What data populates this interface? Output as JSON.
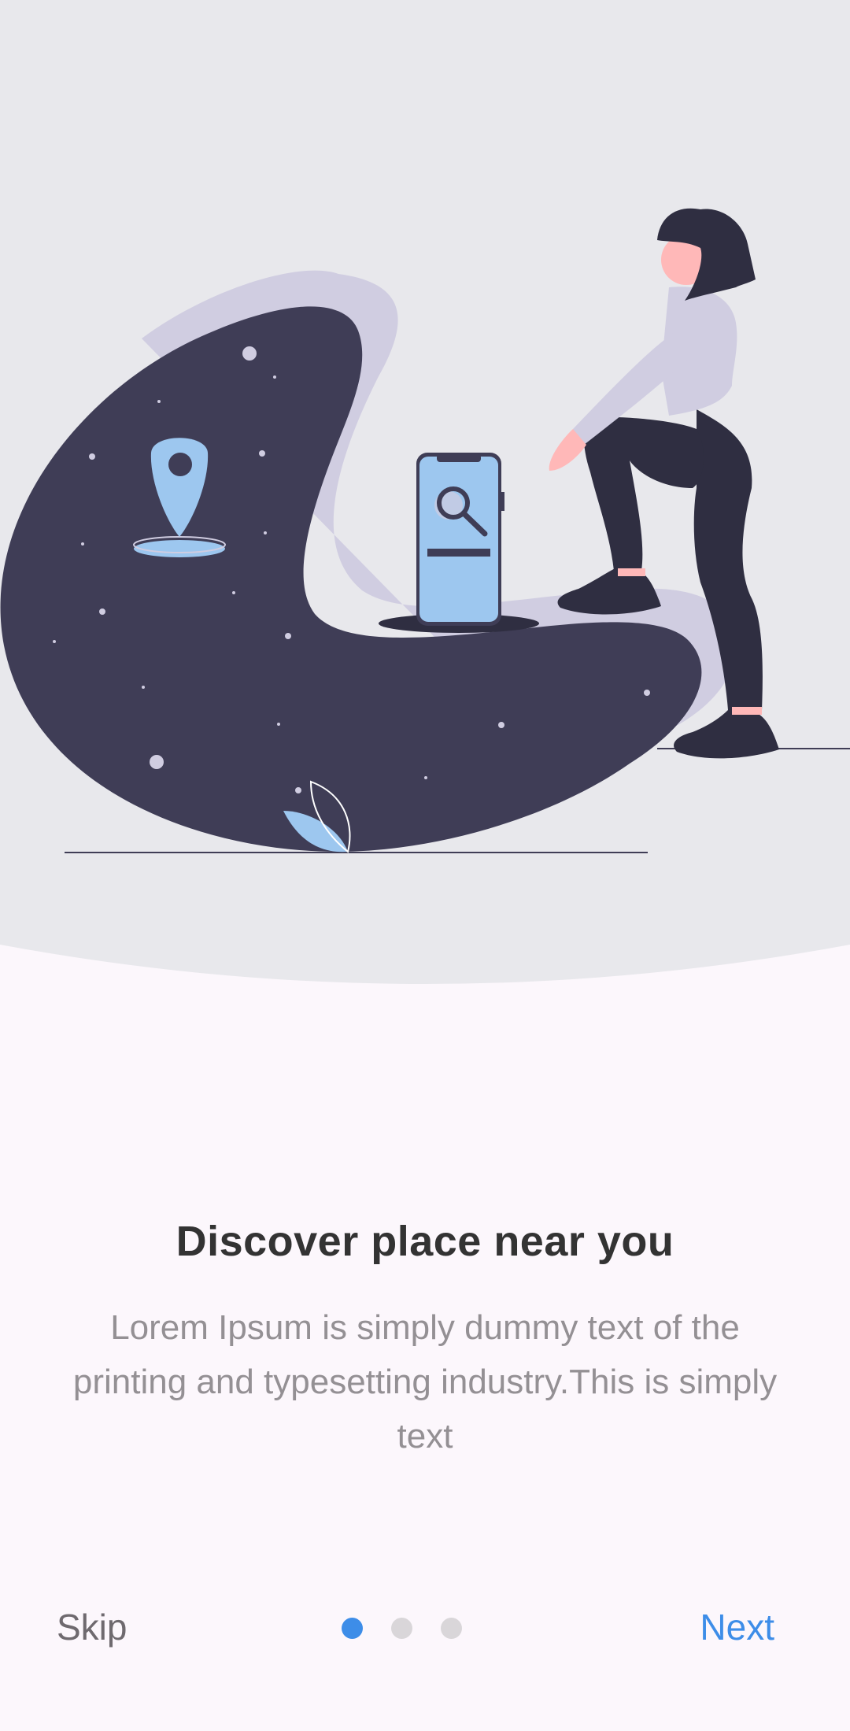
{
  "onboarding": {
    "title": "Discover place near you",
    "description": "Lorem Ipsum is simply dummy text of the printing and typesetting industry.This is simply text",
    "skip_label": "Skip",
    "next_label": "Next",
    "page_count": 3,
    "active_page": 1
  },
  "colors": {
    "hero_bg": "#e8e8ec",
    "content_bg": "#fcf7fc",
    "accent": "#3d8de8",
    "dot_active": "#3d8de8",
    "dot_inactive": "#d9d6d9",
    "blob_dark": "#3f3d56",
    "blob_light": "#d0cde1",
    "illustration_blue": "#9dc7ef",
    "skin": "#ffb8b8",
    "dark": "#2f2e41"
  },
  "illustration": {
    "name": "woman-stepping-on-map-blob-illustration"
  }
}
